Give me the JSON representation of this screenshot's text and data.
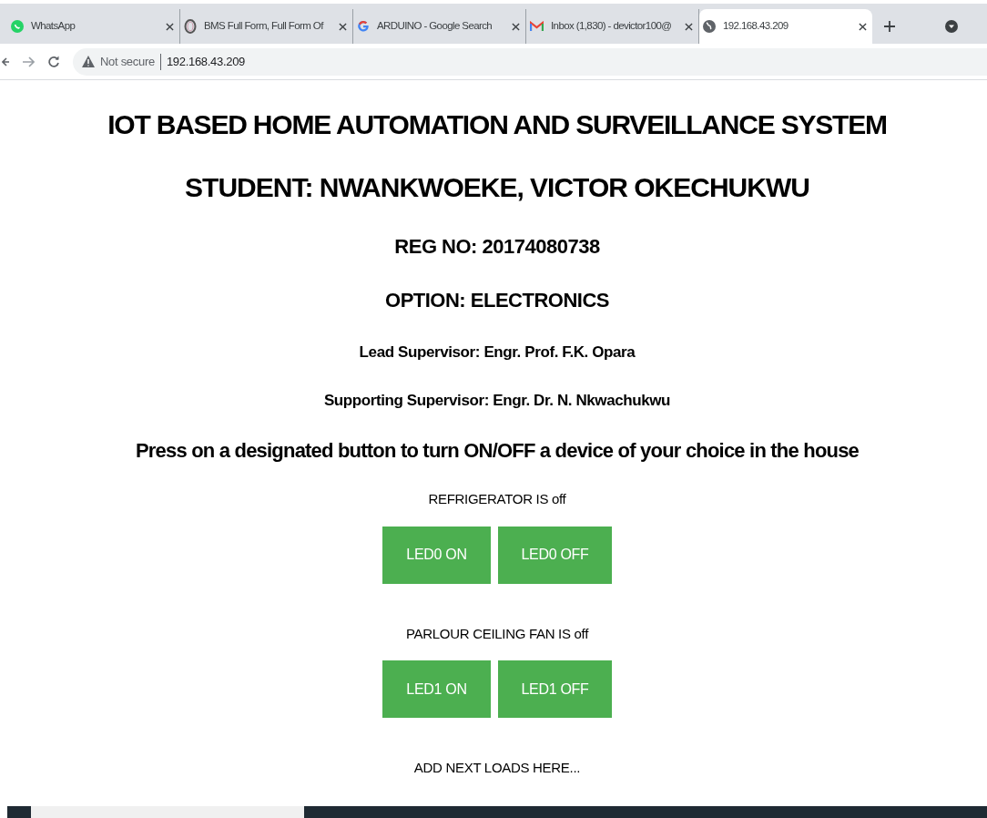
{
  "tabs": [
    {
      "title": "WhatsApp",
      "selected": false
    },
    {
      "title": "BMS Full Form, Full Form Of",
      "selected": false
    },
    {
      "title": "ARDUINO - Google Search",
      "selected": false
    },
    {
      "title": "Inbox (1,830) - devictor100@",
      "selected": false
    },
    {
      "title": "192.168.43.209",
      "selected": true
    }
  ],
  "address_bar": {
    "security": "Not secure",
    "url": "192.168.43.209"
  },
  "page": {
    "title": "IOT BASED HOME AUTOMATION AND SURVEILLANCE SYSTEM",
    "student": "STUDENT: NWANKWOEKE, VICTOR OKECHUKWU",
    "reg_no": "REG NO: 20174080738",
    "option": "OPTION: ELECTRONICS",
    "lead_supervisor": "Lead Supervisor: Engr. Prof. F.K. Opara",
    "supporting_supervisor": "Supporting Supervisor: Engr. Dr. N. Nkwachukwu",
    "instruction": "Press on a designated button to turn ON/OFF a device of your choice in the house",
    "devices": [
      {
        "status": "REFRIGERATOR IS off",
        "buttons": [
          "LED0 ON",
          "LED0 OFF"
        ]
      },
      {
        "status": "PARLOUR CEILING FAN IS off",
        "buttons": [
          "LED1 ON",
          "LED1 OFF"
        ]
      }
    ],
    "footer": "ADD NEXT LOADS HERE..."
  }
}
